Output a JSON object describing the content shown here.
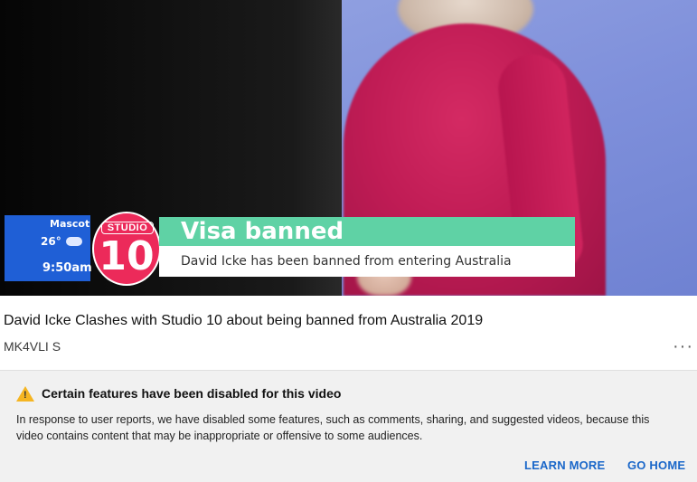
{
  "video": {
    "overlay": {
      "location": "Mascot",
      "temperature": "26°",
      "weather_icon": "cloud-icon",
      "time": "9:50am",
      "logo_top": "STUDIO",
      "logo_number": "10",
      "headline": "Visa banned",
      "subheadline": "David Icke has been banned from entering Australia"
    }
  },
  "meta": {
    "title": "David Icke Clashes with Studio 10 about being banned from Australia 2019",
    "channel": "MK4VLI S",
    "more_icon": "more-vert-icon"
  },
  "notice": {
    "icon": "warning-icon",
    "title": "Certain features have been disabled for this video",
    "body": "In response to user reports, we have disabled some features, such as comments, sharing, and suggested videos, because this video contains content that may be inappropriate or offensive to some audiences.",
    "learn_more": "LEARN MORE",
    "go_home": "GO HOME"
  },
  "colors": {
    "accent": "#1a67c9",
    "warning": "#f5b522",
    "banner_green": "#5fd2a5",
    "logo_pink": "#ec2a5a",
    "info_blue": "#1f5fd6"
  }
}
